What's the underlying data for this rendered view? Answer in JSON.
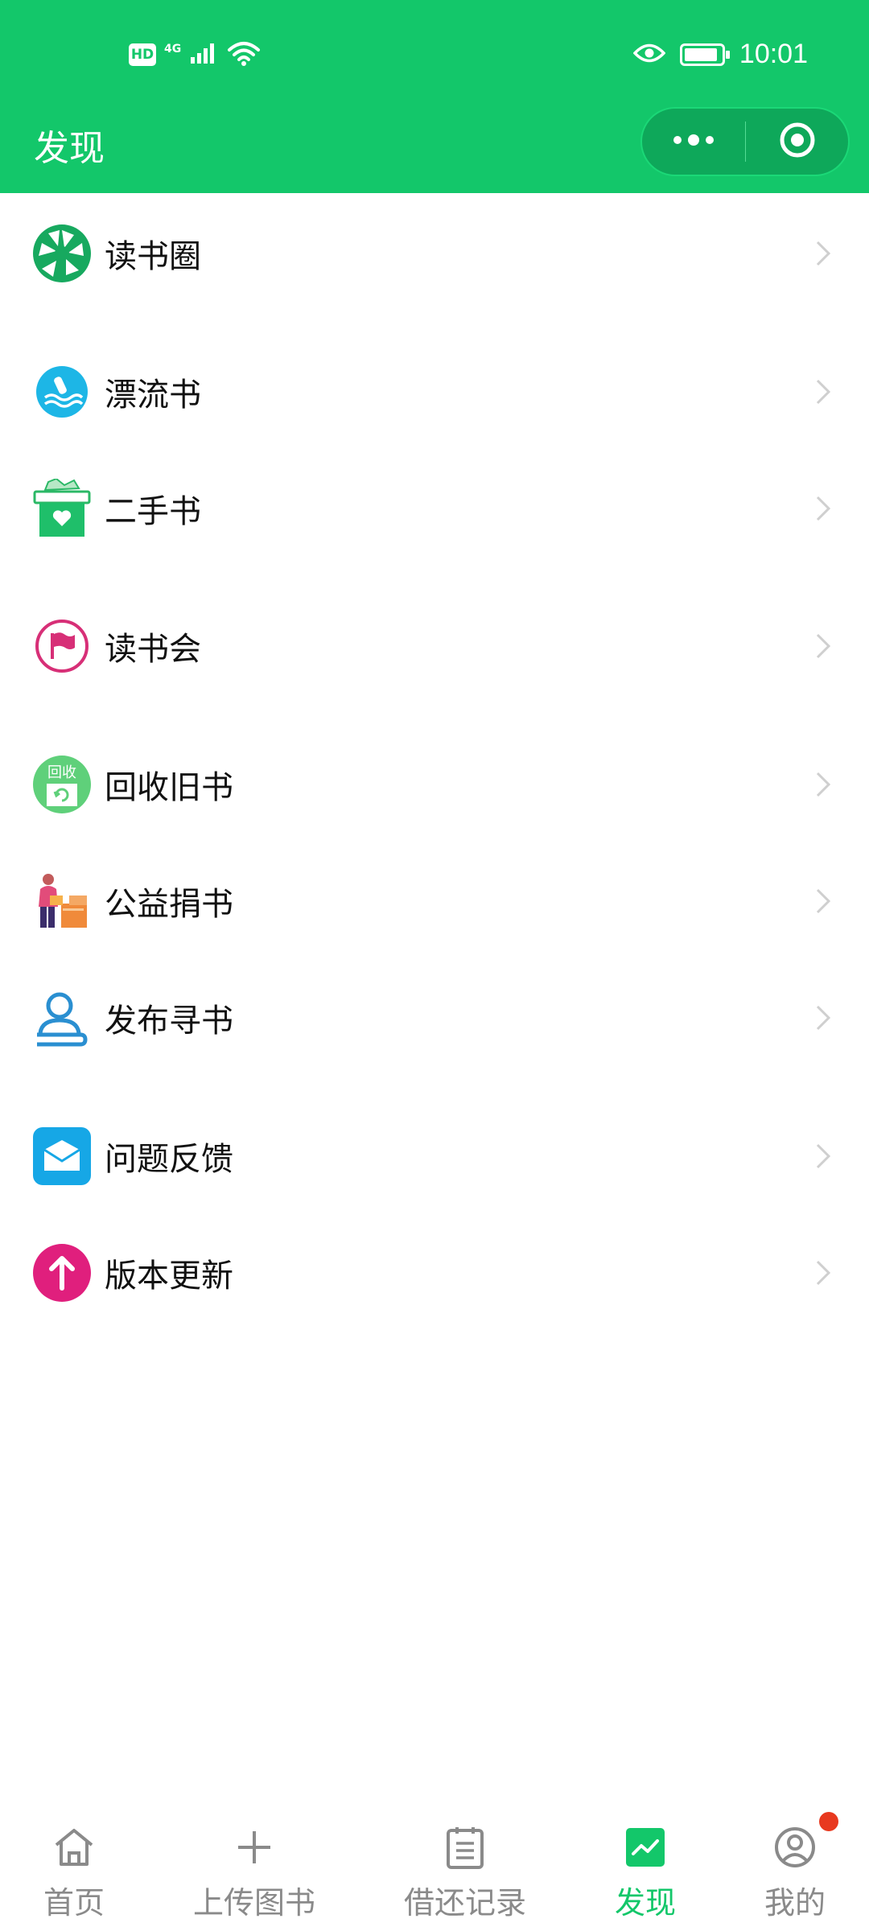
{
  "status_bar": {
    "time": "10:01",
    "network": "4G",
    "hd_badge": "HD"
  },
  "header": {
    "title": "发现",
    "capsule_more_icon": "more-dots-icon",
    "capsule_close_icon": "target-circle-icon"
  },
  "colors": {
    "brand_green": "#13c76a",
    "inactive_gray": "#8a8a8a",
    "notification_red": "#e8391f"
  },
  "menu": {
    "items": [
      {
        "label": "读书圈",
        "icon": "aperture-icon"
      },
      {
        "label": "漂流书",
        "icon": "bottle-drift-icon"
      },
      {
        "label": "二手书",
        "icon": "gift-box-icon"
      },
      {
        "label": "读书会",
        "icon": "flag-icon"
      },
      {
        "label": "回收旧书",
        "icon": "recycle-icon"
      },
      {
        "label": "公益捐书",
        "icon": "donate-books-icon"
      },
      {
        "label": "发布寻书",
        "icon": "search-person-icon"
      },
      {
        "label": "问题反馈",
        "icon": "mail-icon"
      },
      {
        "label": "版本更新",
        "icon": "upload-arrow-icon"
      }
    ],
    "recycle_icon_text": "回收"
  },
  "tabbar": {
    "tabs": [
      {
        "label": "首页",
        "icon": "home-icon"
      },
      {
        "label": "上传图书",
        "icon": "plus-icon"
      },
      {
        "label": "借还记录",
        "icon": "clipboard-icon"
      },
      {
        "label": "发现",
        "icon": "trend-chart-icon",
        "active": true
      },
      {
        "label": "我的",
        "icon": "user-circle-icon",
        "badge": "dot"
      }
    ]
  }
}
